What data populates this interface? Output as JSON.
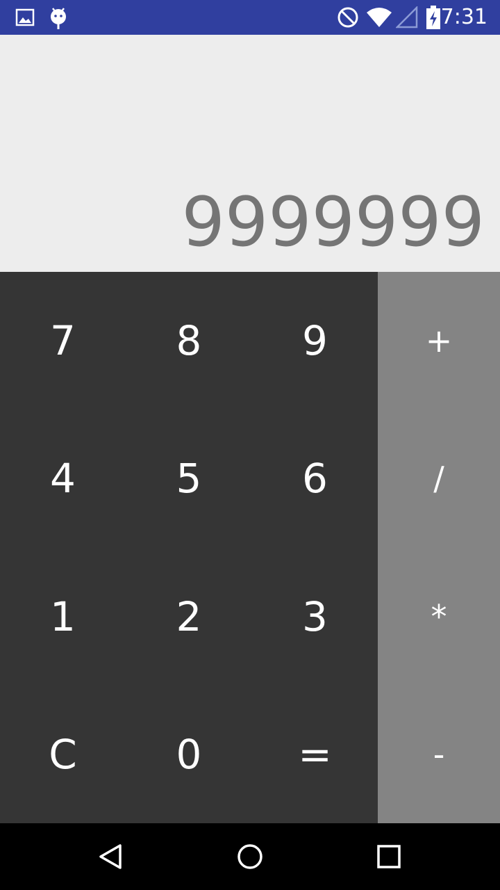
{
  "status_bar": {
    "time": "7:31",
    "icons": [
      "gallery-icon",
      "android-icon",
      "do-not-disturb-icon",
      "wifi-icon",
      "cell-signal-icon",
      "battery-charging-icon"
    ]
  },
  "display": {
    "value": "9999999"
  },
  "keypad": {
    "rows": [
      [
        "7",
        "8",
        "9"
      ],
      [
        "4",
        "5",
        "6"
      ],
      [
        "1",
        "2",
        "3"
      ],
      [
        "C",
        "0",
        "="
      ]
    ]
  },
  "operators": [
    "+",
    "/",
    "*",
    "-"
  ],
  "colors": {
    "status_bar": "#303f9f",
    "display_bg": "#ededed",
    "display_text": "#757575",
    "keypad_bg": "#353535",
    "operator_bg": "#848484",
    "nav_bar": "#000000"
  },
  "nav_bar": {
    "buttons": [
      "back-icon",
      "home-icon",
      "recents-icon"
    ]
  }
}
